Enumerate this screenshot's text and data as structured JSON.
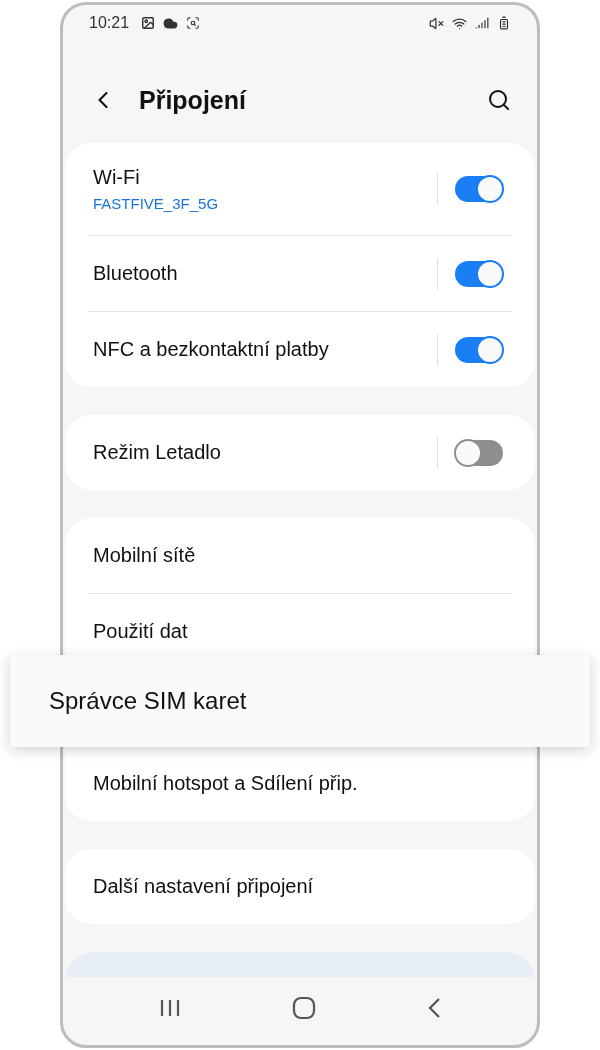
{
  "status_bar": {
    "time": "10:21"
  },
  "header": {
    "title": "Připojení"
  },
  "groups": [
    {
      "rows": [
        {
          "kind": "toggle",
          "label": "Wi-Fi",
          "subtitle": "FASTFIVE_3F_5G",
          "on": true
        },
        {
          "kind": "toggle",
          "label": "Bluetooth",
          "on": true
        },
        {
          "kind": "toggle",
          "label": "NFC a bezkontaktní platby",
          "on": true
        }
      ]
    },
    {
      "rows": [
        {
          "kind": "toggle",
          "label": "Režim Letadlo",
          "on": false
        }
      ]
    },
    {
      "rows": [
        {
          "kind": "link",
          "label": "Mobilní sítě"
        },
        {
          "kind": "link",
          "label": "Použití dat"
        },
        {
          "kind": "popout",
          "label": "Správce SIM karet"
        },
        {
          "kind": "link",
          "label": "Mobilní hotspot a Sdílení přip."
        }
      ]
    },
    {
      "rows": [
        {
          "kind": "link",
          "label": "Další nastavení připojení"
        }
      ]
    }
  ]
}
